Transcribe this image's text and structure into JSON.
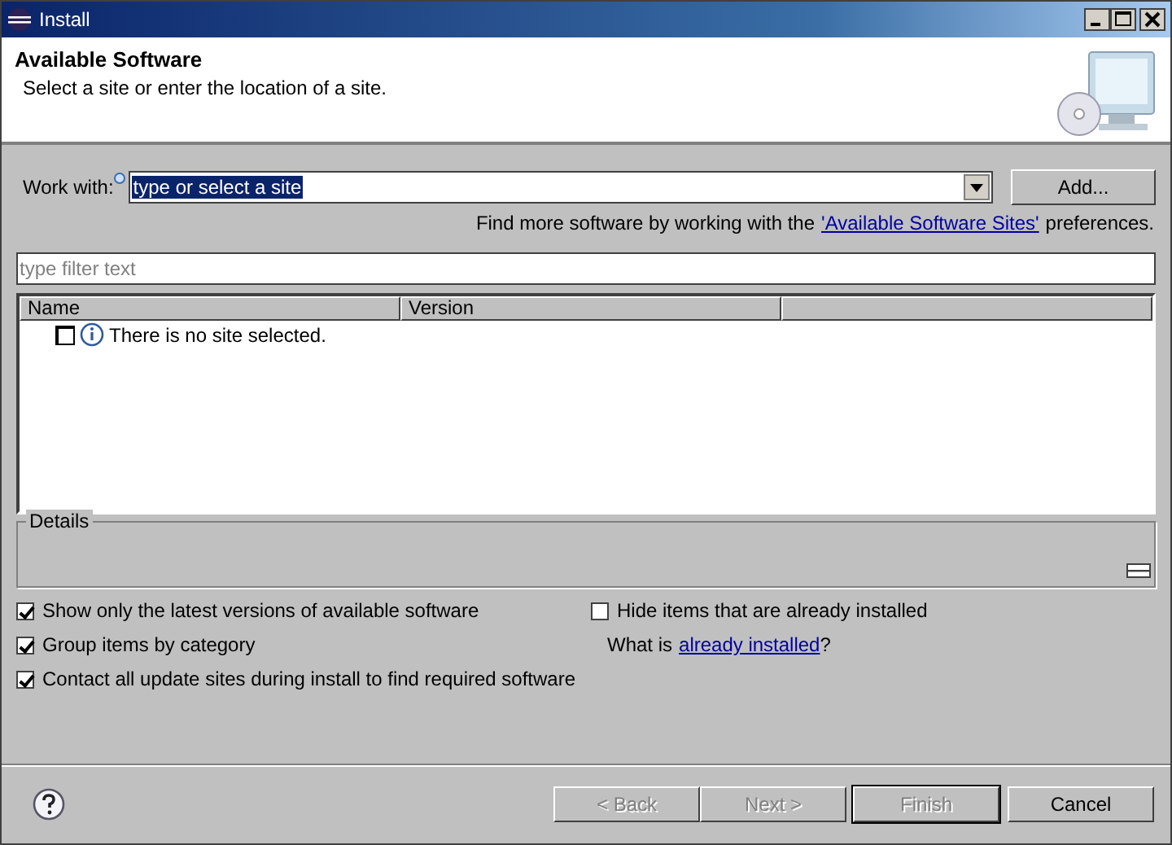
{
  "window": {
    "title": "Install"
  },
  "header": {
    "title": "Available Software",
    "description": "Select a site or enter the location of a site."
  },
  "work_with": {
    "label": "Work with:",
    "value": "type or select a site",
    "value_selected": true,
    "add_button": "Add..."
  },
  "more_software": {
    "text": "Find more software by working with the",
    "link": "'Available Software Sites'",
    "suffix": "preferences."
  },
  "filter": {
    "placeholder": "type filter text"
  },
  "table": {
    "columns": [
      "Name",
      "Version"
    ],
    "rows": [
      {
        "checked": false,
        "text": "There is no site selected."
      }
    ]
  },
  "details": {
    "label": "Details"
  },
  "options": [
    {
      "label": "Show only the latest versions of available software",
      "checked": true
    },
    {
      "label": "Group items by category",
      "checked": true
    },
    {
      "label": "Contact all update sites during install to find required software",
      "checked": true
    }
  ],
  "hide_installed": {
    "label": "Hide items that are already installed",
    "checked": false
  },
  "installed_question": {
    "text": "What is",
    "link": "already installed",
    "suffix": "?"
  },
  "buttons": [
    {
      "label": "< Back",
      "disabled": true,
      "default": false
    },
    {
      "label": "Next >",
      "disabled": true,
      "default": false
    },
    {
      "label": "Finish",
      "disabled": true,
      "default": true
    },
    {
      "label": "Cancel",
      "disabled": false,
      "default": false
    }
  ]
}
